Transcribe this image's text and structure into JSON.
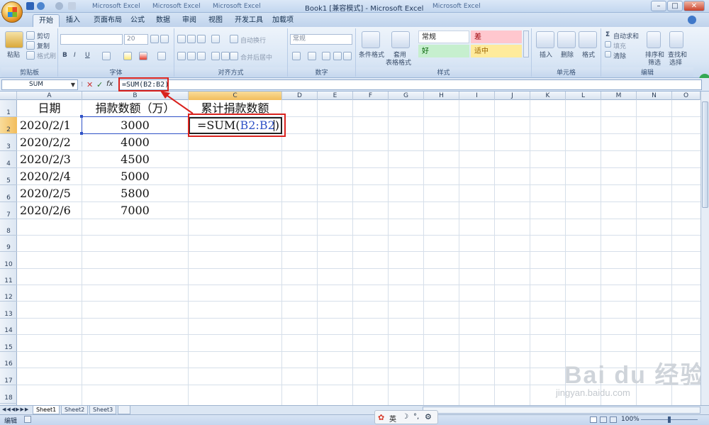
{
  "window": {
    "title": "Book1  [兼容模式] - Microsoft Excel",
    "other_tabs": [
      "Microsoft Excel",
      "Microsoft Excel",
      "Microsoft Excel",
      "Microsoft Excel"
    ]
  },
  "tabs": [
    "开始",
    "插入",
    "页面布局",
    "公式",
    "数据",
    "审阅",
    "视图",
    "开发工具",
    "加载项"
  ],
  "ribbon": {
    "clipboard": {
      "paste": "粘贴",
      "cut": "剪切",
      "copy": "复制",
      "format_painter": "格式刷",
      "label": "剪贴板"
    },
    "font": {
      "size": "20",
      "label": "字体",
      "bold": "B",
      "italic": "I",
      "underline": "U"
    },
    "alignment": {
      "wrap": "自动换行",
      "merge": "合并后居中",
      "label": "对齐方式"
    },
    "number": {
      "format": "常规",
      "label": "数字"
    },
    "styles": {
      "cond": "条件格式",
      "table1": "套用",
      "table2": "表格格式",
      "normal": "常规",
      "bad": "差",
      "good": "好",
      "neutral": "适中",
      "label": "样式"
    },
    "cells": {
      "insert": "插入",
      "delete": "删除",
      "format": "格式",
      "label": "单元格"
    },
    "editing": {
      "autosum": "自动求和",
      "fill": "填充",
      "clear": "清除",
      "sort1": "排序和",
      "sort2": "筛选",
      "find1": "查找和",
      "find2": "选择",
      "label": "编辑"
    }
  },
  "formula_bar": {
    "name_box": "SUM",
    "formula": "=SUM(B2:B2)"
  },
  "columns": [
    "A",
    "B",
    "C",
    "D",
    "E",
    "F",
    "G",
    "H",
    "I",
    "J",
    "K",
    "L",
    "M",
    "N",
    "O"
  ],
  "rows": [
    "1",
    "2",
    "3",
    "4",
    "5",
    "6",
    "7",
    "8",
    "9",
    "10",
    "11",
    "12",
    "13",
    "14",
    "15",
    "16",
    "17",
    "18"
  ],
  "table": {
    "headers": [
      "日期",
      "捐款数额（万）",
      "累计捐款数额"
    ],
    "rows": [
      [
        "2020/2/1",
        "3000",
        "=SUM(B2:B2)"
      ],
      [
        "2020/2/2",
        "4000",
        ""
      ],
      [
        "2020/2/3",
        "4500",
        ""
      ],
      [
        "2020/2/4",
        "5000",
        ""
      ],
      [
        "2020/2/5",
        "5800",
        ""
      ],
      [
        "2020/2/6",
        "7000",
        ""
      ]
    ]
  },
  "editing_cell": {
    "prefix": "=SUM(",
    "ref": "B2:B2",
    "suffix": ")"
  },
  "sheets": [
    "Sheet1",
    "Sheet2",
    "Sheet3"
  ],
  "status": {
    "mode": "编辑",
    "zoom": "100%",
    "ime": "英"
  },
  "watermark": {
    "brand": "Bai du 经验",
    "url": "jingyan.baidu.com"
  },
  "colors": {
    "annotation": "#d9221e",
    "ref_blue": "#2f52c7"
  }
}
